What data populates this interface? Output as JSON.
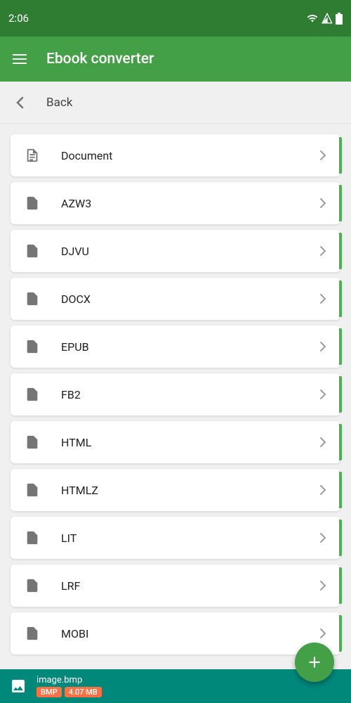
{
  "statusBar": {
    "time": "2:06"
  },
  "appBar": {
    "title": "Ebook converter"
  },
  "backBar": {
    "label": "Back"
  },
  "formats": [
    {
      "label": "Document"
    },
    {
      "label": "AZW3"
    },
    {
      "label": "DJVU"
    },
    {
      "label": "DOCX"
    },
    {
      "label": "EPUB"
    },
    {
      "label": "FB2"
    },
    {
      "label": "HTML"
    },
    {
      "label": "HTMLZ"
    },
    {
      "label": "LIT"
    },
    {
      "label": "LRF"
    },
    {
      "label": "MOBI"
    }
  ],
  "bottomBar": {
    "filename": "image.bmp",
    "format": "BMP",
    "size": "4.07 MB"
  }
}
